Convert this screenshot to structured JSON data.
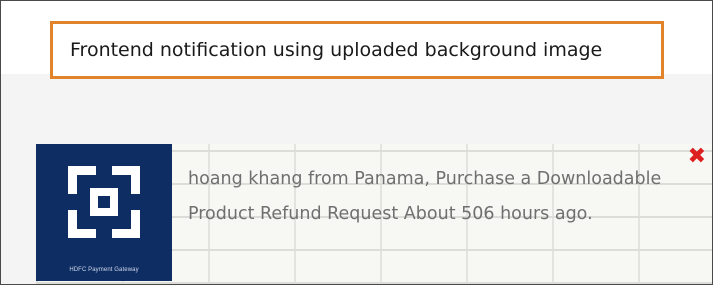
{
  "caption": {
    "text": "Frontend notification using uploaded background image",
    "border_color": "#e0832a"
  },
  "notification": {
    "thumbnail": {
      "brand_caption": "HDFC Payment Gateway",
      "background_color": "#0d2d63"
    },
    "message": "hoang khang from Panama, Purchase a Downloadable Product Refund Request About 506 hours ago.",
    "close_icon": "close-icon",
    "close_color": "#dd1f1f"
  }
}
